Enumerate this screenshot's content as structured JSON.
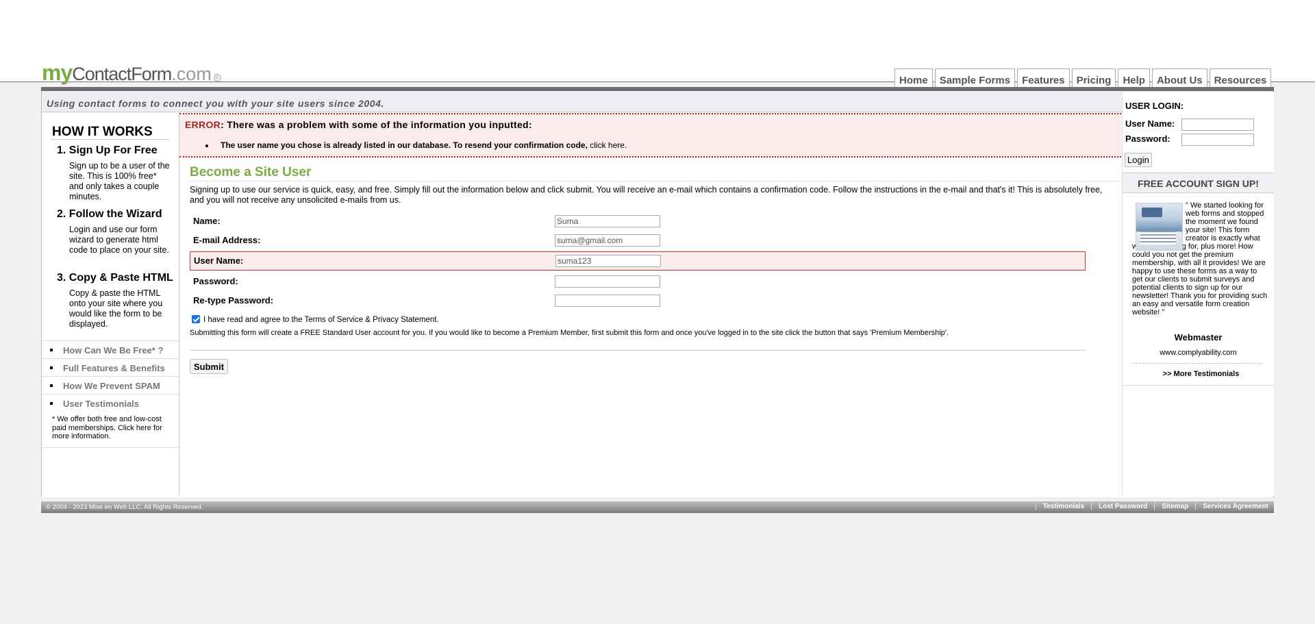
{
  "logo": {
    "my": "my",
    "contact": "ContactForm",
    "dotcom": ".com",
    "reg": "R"
  },
  "nav": [
    "Home",
    "Sample Forms",
    "Features",
    "Pricing",
    "Help",
    "About Us",
    "Resources"
  ],
  "tagline": "Using contact forms to connect you with your site users since 2004.",
  "sidebar": {
    "title": "HOW IT WORKS",
    "steps": [
      {
        "title": "1. Sign Up For Free",
        "desc": "Sign up to be a user of the site. This is 100% free* and only takes a couple minutes."
      },
      {
        "title": "2. Follow the Wizard",
        "desc": "Login and use our form wizard to generate html code to place on your site."
      },
      {
        "title": "3. Copy & Paste HTML",
        "desc": "Copy & paste the HTML onto your site where you would like the form to be displayed."
      }
    ],
    "links": [
      "How Can We Be Free* ?",
      "Full Features & Benefits",
      "How We Prevent SPAM",
      "User Testimonials"
    ],
    "note": "* We offer both free and low-cost paid memberships. Click here for more information."
  },
  "error": {
    "label": "ERROR",
    "heading": ": There was a problem with some of the information you inputted:",
    "message": "The user name you chose is already listed in our database. To resend your confirmation code, ",
    "link": "click here."
  },
  "form": {
    "title": "Become a Site User",
    "intro": "Signing up to use our service is quick, easy, and free. Simply fill out the information below and click submit. You will receive an e-mail which contains a confirmation code. Follow the instructions in the e-mail and that's it! This is absolutely free, and you will not receive any unsolicited e-mails from us.",
    "name_label": "Name:",
    "name_value": "Suma",
    "email_label": "E-mail Address:",
    "email_value": "suma@gmail.com",
    "username_label": "User Name:",
    "username_value": "suma123",
    "password_label": "Password:",
    "password_value": "",
    "retype_label": "Re-type Password:",
    "retype_value": "",
    "agree_checked": true,
    "agree_text": "I have read and agree to the Terms of Service & Privacy Statement.",
    "submit_note": "Submitting this form will create a FREE Standard User account for you. If you would like to become a Premium Member, first submit this form and once you've logged in to the site click the button that says 'Premium Membership'.",
    "submit_label": "Submit"
  },
  "login": {
    "title": "USER LOGIN:",
    "username_label": "User Name:",
    "password_label": "Password:",
    "button": "Login"
  },
  "signup": {
    "title": "FREE ACCOUNT SIGN UP!",
    "testimonial": "\" We started looking for web forms and stopped the moment we found your site! This form creator is exactly what we were looking for, plus more! How could you not get the premium membership, with all it provides! We are happy to use these forms as a way to get our clients to submit surveys and potential clients to sign up for our newsletter! Thank you for providing such an easy and versatile form creation website! \"",
    "author": "Webmaster",
    "site": "www.complyability.com",
    "more": ">> More Testimonials"
  },
  "footer": {
    "copyright": "© 2004 - 2023 Mise en Web LLC. All Rights Reserved.",
    "links": [
      "Testimonials",
      "Lost Password",
      "Sitemap",
      "Services Agreement"
    ]
  },
  "colors": {
    "brand_green": "#7caa44",
    "error_red": "#b02020",
    "error_bg": "#fbecec"
  }
}
